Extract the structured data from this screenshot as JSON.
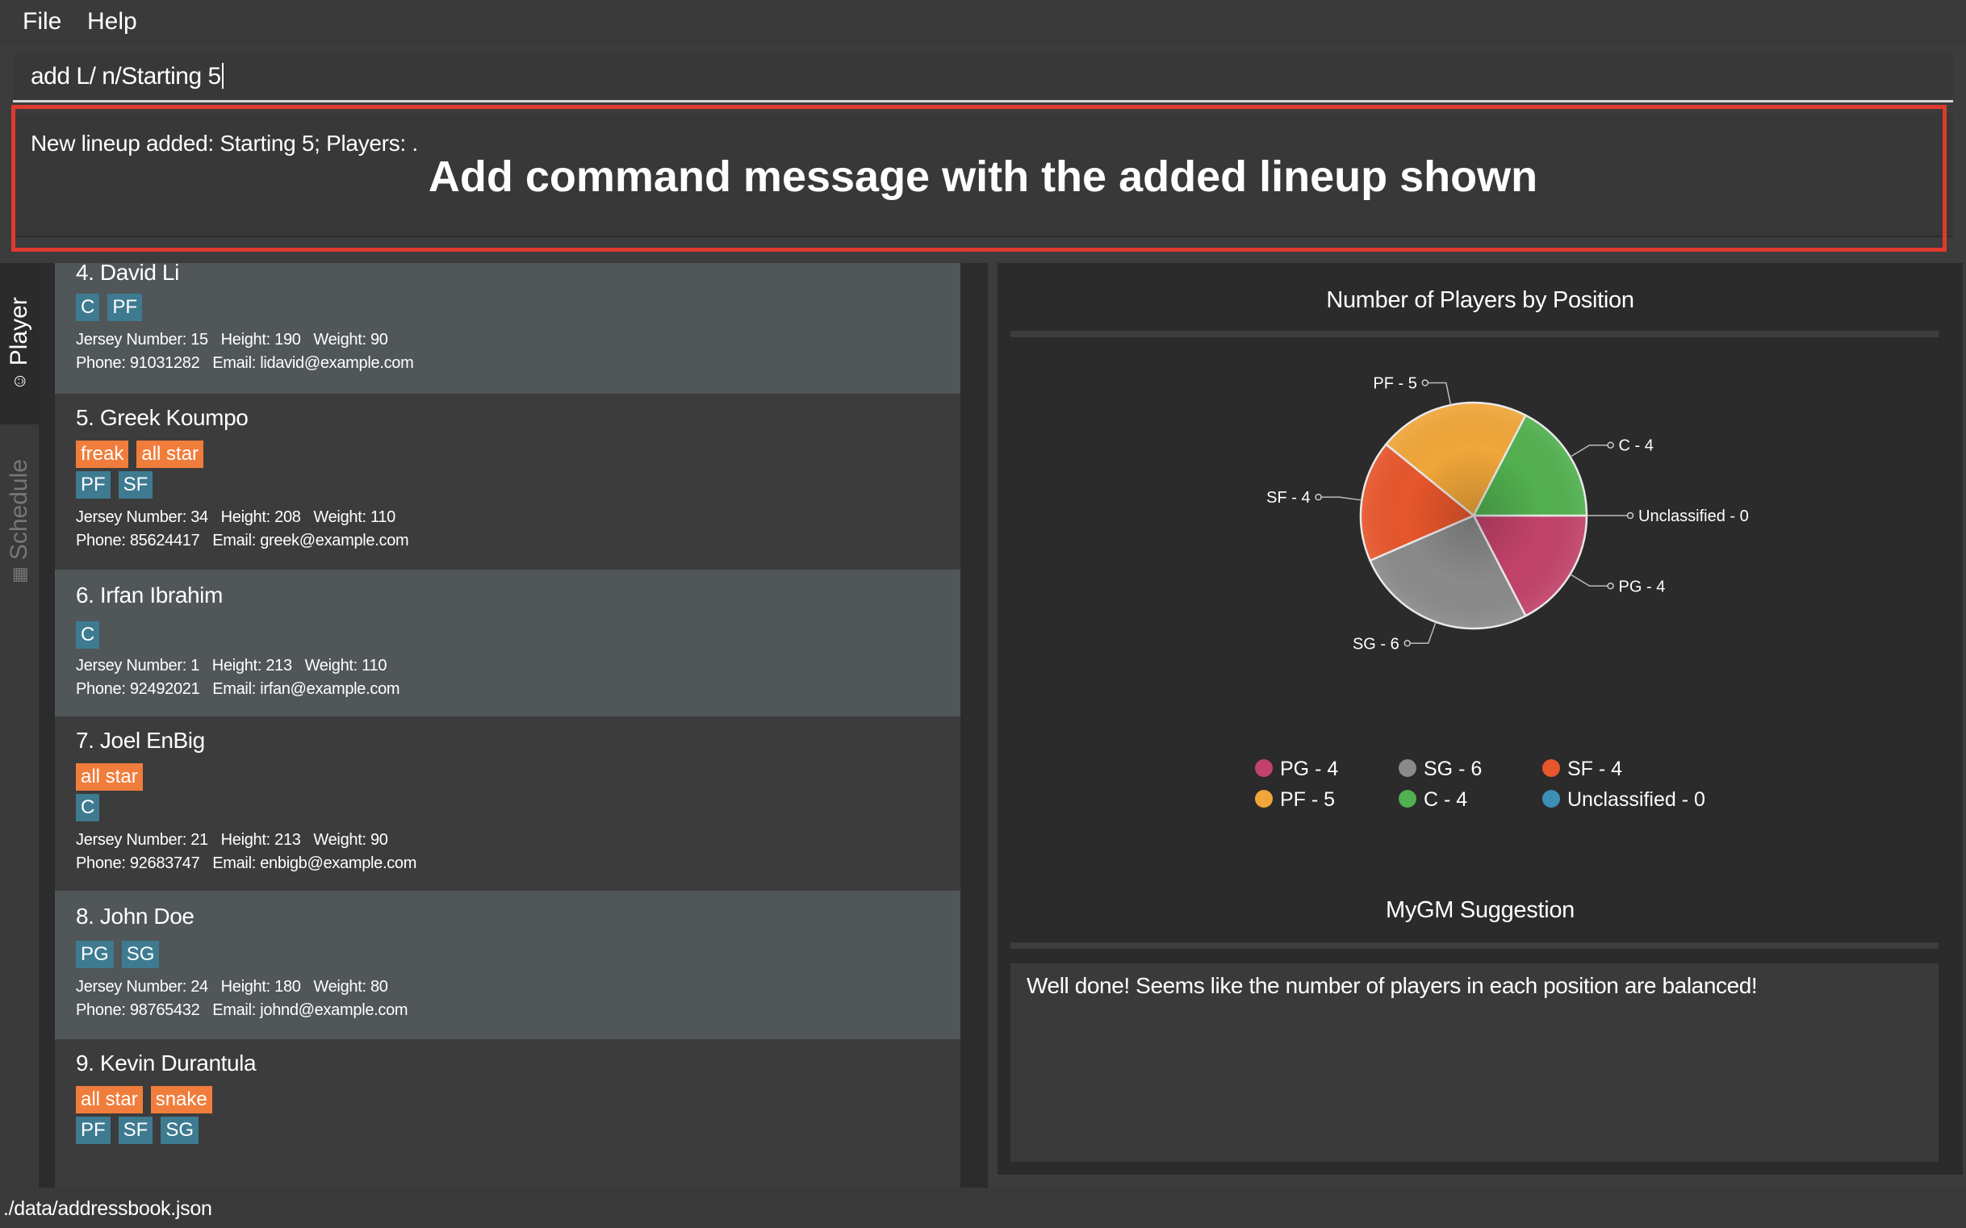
{
  "menu": {
    "file": "File",
    "help": "Help"
  },
  "command": {
    "value": "add L/ n/Starting 5"
  },
  "result": {
    "message": "New lineup added: Starting 5; Players: ."
  },
  "annotation": "Add command message with the added lineup shown",
  "tabs": {
    "player": "Player",
    "schedule": "Schedule",
    "player_icon": "smiley-icon",
    "schedule_icon": "calendar-icon"
  },
  "players": [
    {
      "title": "4.  David Li",
      "labels": [],
      "positions": [
        "C",
        "PF"
      ],
      "stats": "Jersey Number: 15   Height: 190   Weight: 90",
      "contact": "Phone: 91031282   Email: lidavid@example.com"
    },
    {
      "title": "5.  Greek Koumpo",
      "labels": [
        "freak",
        "all star"
      ],
      "positions": [
        "PF",
        "SF"
      ],
      "stats": "Jersey Number: 34   Height: 208   Weight: 110",
      "contact": "Phone: 85624417   Email: greek@example.com"
    },
    {
      "title": "6.  Irfan Ibrahim",
      "labels": [],
      "positions": [
        "C"
      ],
      "stats": "Jersey Number: 1   Height: 213   Weight: 110",
      "contact": "Phone: 92492021   Email: irfan@example.com"
    },
    {
      "title": "7.  Joel EnBig",
      "labels": [
        "all star"
      ],
      "positions": [
        "C"
      ],
      "stats": "Jersey Number: 21   Height: 213   Weight: 90",
      "contact": "Phone: 92683747   Email: enbigb@example.com"
    },
    {
      "title": "8.  John Doe",
      "labels": [],
      "positions": [
        "PG",
        "SG"
      ],
      "stats": "Jersey Number: 24   Height: 180   Weight: 80",
      "contact": "Phone: 98765432   Email: johnd@example.com"
    },
    {
      "title": "9.  Kevin Durantula",
      "labels": [
        "all star",
        "snake"
      ],
      "positions": [
        "PF",
        "SF",
        "SG"
      ],
      "stats": "",
      "contact": ""
    }
  ],
  "chart_data": {
    "type": "pie",
    "title": "Number of Players by Position",
    "categories": [
      "PG",
      "SG",
      "SF",
      "PF",
      "C",
      "Unclassified"
    ],
    "values": [
      4,
      6,
      4,
      5,
      4,
      0
    ],
    "slice_labels": [
      "PG - 4",
      "SG - 6",
      "SF - 4",
      "PF - 5",
      "C - 4",
      "Unclassified - 0"
    ],
    "colors": [
      "#c2426a",
      "#8a8a8a",
      "#e7562c",
      "#f0a63a",
      "#52b04f",
      "#3d8fb6"
    ],
    "legend_placement": "bottom"
  },
  "suggestion": {
    "title": "MyGM Suggestion",
    "text": "Well done! Seems like the number of players in each position are balanced!"
  },
  "status": {
    "path": "./data/addressbook.json"
  }
}
